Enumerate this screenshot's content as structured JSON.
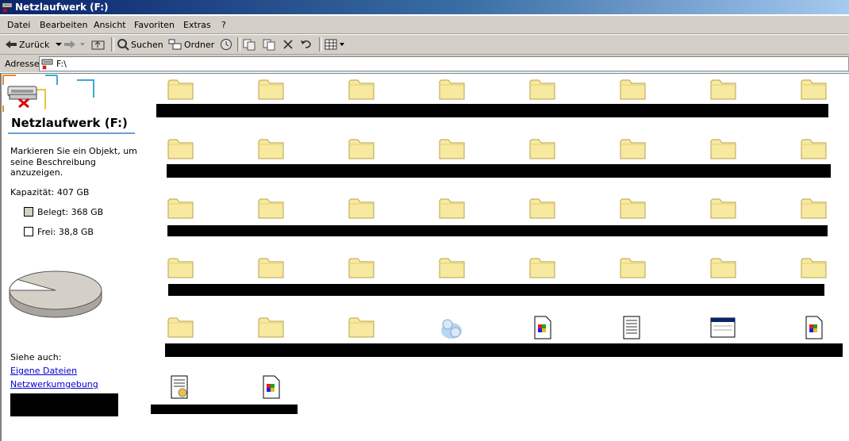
{
  "window": {
    "title": "Netzlaufwerk (F:)"
  },
  "menu": [
    "Datei",
    "Bearbeiten",
    "Ansicht",
    "Favoriten",
    "Extras",
    "?"
  ],
  "toolbar": {
    "back_label": "Zurück",
    "search_label": "Suchen",
    "folders_label": "Ordner"
  },
  "address": {
    "label": "Adresse",
    "value": "F:\\"
  },
  "left_pane": {
    "title": "Netzlaufwerk (F:)",
    "hint": [
      "Markieren Sie ein Objekt, um",
      "seine Beschreibung anzuzeigen."
    ],
    "capacity": "Kapazität: 407 GB",
    "used": "Belegt: 368 GB",
    "free": "Frei: 38,8 GB",
    "pie": {
      "used_fraction": 0.904,
      "used_color": "#d4d0c8",
      "free_color": "#ffffff"
    },
    "see_also_label": "Siehe auch:",
    "links": [
      "Eigene Dateien",
      "Netzwerkumgebung"
    ]
  },
  "files": {
    "row1": [
      "folder",
      "folder",
      "folder",
      "folder",
      "folder",
      "folder",
      "folder",
      "folder"
    ],
    "row2": [
      "folder",
      "folder",
      "folder",
      "folder",
      "folder",
      "folder",
      "folder",
      "folder"
    ],
    "row3": [
      "folder",
      "folder",
      "folder",
      "folder",
      "folder",
      "folder",
      "folder",
      "folder"
    ],
    "row4": [
      "folder",
      "folder",
      "folder",
      "folder",
      "folder",
      "folder",
      "folder",
      "folder"
    ],
    "row5": [
      "folder",
      "folder",
      "folder",
      "network-drive-app",
      "media-doc",
      "text-doc",
      "window-app",
      "media-doc"
    ],
    "row6": [
      "settings-doc",
      "media-doc"
    ]
  }
}
